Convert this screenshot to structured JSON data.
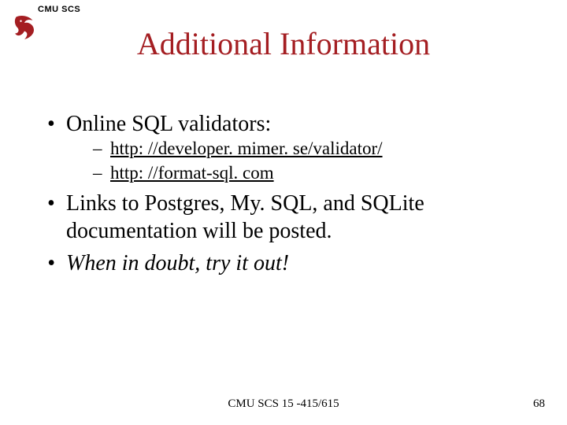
{
  "header": {
    "label": "CMU SCS"
  },
  "title": "Additional Information",
  "bullets": {
    "b1": {
      "text": "Online SQL validators:"
    },
    "sub": {
      "link1": "http: //developer. mimer. se/validator/",
      "link2": "http: //format-sql. com"
    },
    "b2": {
      "text": "Links to Postgres, My. SQL, and SQLite documentation will be posted."
    },
    "b3": {
      "text": "When in doubt, try it out!"
    }
  },
  "footer": {
    "center": "CMU SCS 15 -415/615",
    "page": "68"
  },
  "colors": {
    "accent": "#a41e22"
  }
}
